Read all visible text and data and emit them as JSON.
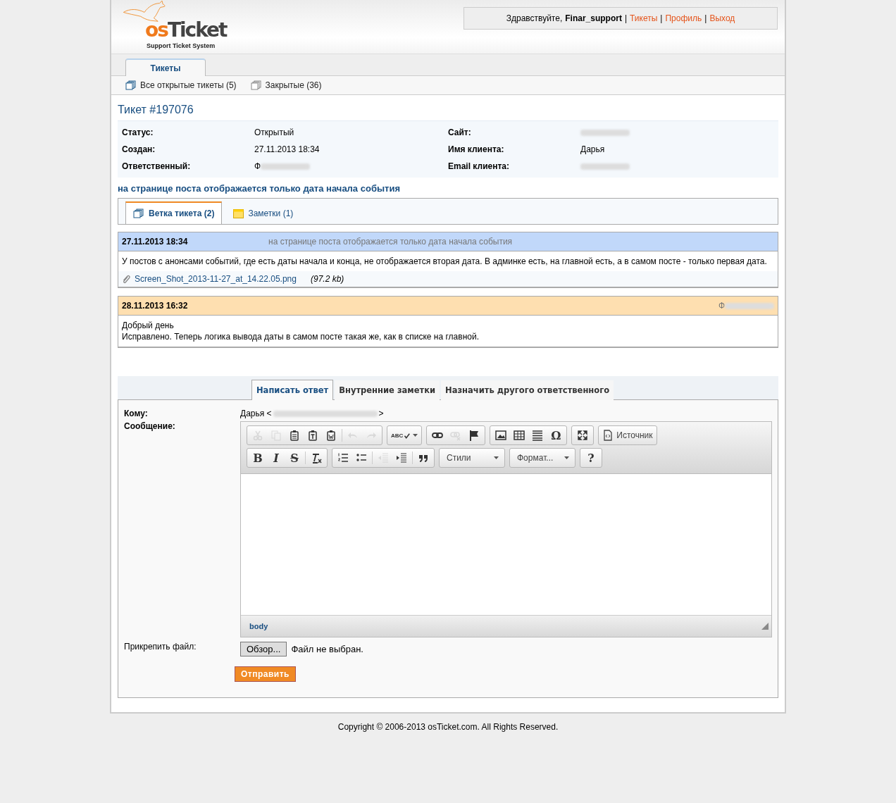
{
  "header": {
    "logo": {
      "prefix": "os",
      "name": "Ticket",
      "subtitle": "Support Ticket System"
    },
    "greeting": "Здравствуйте,",
    "user": "Finar_support",
    "links": [
      {
        "separator": "|",
        "label": "Тикеты"
      },
      {
        "separator": "|",
        "label": "Профиль"
      },
      {
        "separator": "|",
        "label": "Выход"
      }
    ]
  },
  "nav_tabs": [
    {
      "label": "Тикеты",
      "selected": true
    }
  ],
  "subnav": [
    {
      "label": "Все открытые тикеты (5)",
      "active": true
    },
    {
      "label": "Закрытые (36)",
      "active": false
    }
  ],
  "ticket": {
    "title": "Тикет #197076",
    "info_left": [
      {
        "label": "Статус:",
        "value": "Открытый",
        "redacted": false
      },
      {
        "label": "Создан:",
        "value": "27.11.2013 18:34",
        "redacted": false
      },
      {
        "label": "Ответственный:",
        "value": "Ф",
        "redacted": true
      }
    ],
    "info_right": [
      {
        "label": "Сайт:",
        "redacted": true
      },
      {
        "label": "Имя клиента:",
        "value": "Дарья",
        "redacted": false
      },
      {
        "label": "Email клиента:",
        "redacted": true
      }
    ],
    "subject": "на странице поста отображается только дата начала события"
  },
  "thread_tabs": [
    {
      "label": "Ветка тикета (2)",
      "kind": "thread",
      "selected": true
    },
    {
      "label": "Заметки (1)",
      "kind": "notes",
      "selected": false
    }
  ],
  "thread": [
    {
      "kind": "message",
      "date": "27.11.2013 18:34",
      "subject": "на странице поста отображается только дата начала события",
      "author_redacted": false,
      "body": [
        "У постов с анонсами событий, где есть даты начала и конца, не отображается вторая дата. В админке есть, на главной есть, а в самом посте - только первая дата."
      ],
      "attachments": [
        {
          "name": "Screen_Shot_2013-11-27_at_14.22.05.png",
          "size": "(97.2 kb)"
        }
      ]
    },
    {
      "kind": "response",
      "date": "28.11.2013 16:32",
      "author": "Ф",
      "author_redacted": true,
      "body": [
        "Добрый день",
        "Исправлено. Теперь логика вывода даты в самом посте такая же, как в списке на главной."
      ]
    }
  ],
  "reply_tabs": [
    {
      "label": "Написать ответ",
      "selected": true
    },
    {
      "label": "Внутренние заметки",
      "selected": false
    },
    {
      "label": "Назначить другого ответственного",
      "selected": false
    }
  ],
  "reply": {
    "to_label": "Кому:",
    "to_name": "Дарья <",
    "to_end": ">",
    "to_redacted": true,
    "message_label": "Сообщение:",
    "toolbar": [
      [
        [
          {
            "kind": "cut",
            "disabled": true
          },
          {
            "kind": "copy",
            "disabled": true
          },
          {
            "kind": "paste",
            "disabled": false
          },
          {
            "kind": "paste-text",
            "disabled": false
          },
          {
            "kind": "paste-word",
            "disabled": false
          },
          {
            "kind": "sep"
          },
          {
            "kind": "undo",
            "disabled": true
          },
          {
            "kind": "redo",
            "disabled": true
          }
        ],
        [
          {
            "kind": "spell",
            "label": "ABC",
            "disabled": false
          }
        ],
        [
          {
            "kind": "link",
            "disabled": false
          },
          {
            "kind": "unlink",
            "disabled": true
          },
          {
            "kind": "anchor",
            "disabled": false
          }
        ],
        [
          {
            "kind": "image",
            "disabled": false
          },
          {
            "kind": "table",
            "disabled": false
          },
          {
            "kind": "hr",
            "disabled": false
          },
          {
            "kind": "glyph",
            "label": "Ω",
            "disabled": false
          }
        ],
        [
          {
            "kind": "maximize",
            "disabled": false
          }
        ],
        [
          {
            "kind": "source",
            "label": "Источник",
            "disabled": false
          }
        ]
      ],
      [
        [
          {
            "kind": "glyph",
            "label": "B",
            "disabled": false
          },
          {
            "kind": "italic",
            "label": "I",
            "disabled": false
          },
          {
            "kind": "strike",
            "label": "S",
            "disabled": false
          },
          {
            "kind": "sep"
          },
          {
            "kind": "removeformat",
            "disabled": false
          }
        ],
        [
          {
            "kind": "ol",
            "disabled": false
          },
          {
            "kind": "ul",
            "disabled": false
          },
          {
            "kind": "sep"
          },
          {
            "kind": "outdent",
            "disabled": true
          },
          {
            "kind": "indent",
            "disabled": false
          },
          {
            "kind": "sep"
          },
          {
            "kind": "quote",
            "disabled": false
          }
        ],
        [
          {
            "kind": "combo",
            "label": "Стили",
            "disabled": false
          }
        ],
        [
          {
            "kind": "combo",
            "label": "Формат...",
            "disabled": false
          }
        ],
        [
          {
            "kind": "glyph",
            "label": "?",
            "disabled": false
          }
        ]
      ]
    ],
    "path": "body",
    "attach_label": "Прикрепить файл:",
    "browse": "Обзор...",
    "no_file": "Файл не выбран.",
    "submit": "Отправить"
  },
  "footer": "Copyright © 2006-2013 osTicket.com.  All Rights Reserved."
}
